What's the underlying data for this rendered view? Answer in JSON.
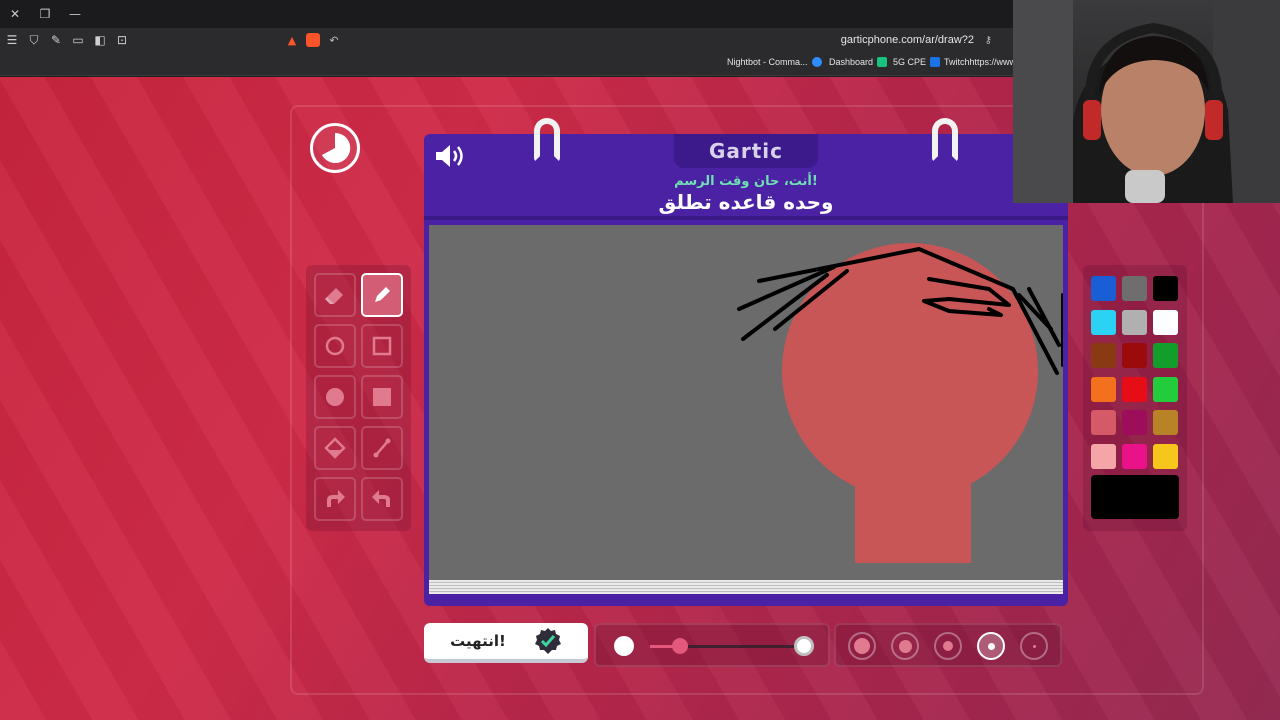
{
  "browser": {
    "window_controls": [
      "✕",
      "❐",
      "—"
    ],
    "url": "garticphone.com/ar/draw?2",
    "bookmarks": [
      {
        "label": "Nightbot - Comma...",
        "color": "#2e8cff"
      },
      {
        "label": "Dashboard",
        "color": "#19c37d"
      },
      {
        "label": "5G CPE",
        "color": "#1a73e8"
      },
      {
        "label": "Twitchhttps://www.t",
        "color": "#9146ff"
      }
    ]
  },
  "game": {
    "brand": "Gartic",
    "subtitle": "أنت، حان وقت الرسم!",
    "prompt": "وحده قاعده تطلق",
    "done_label": "انتهيت!",
    "canvas_bg": "#6b6b6b",
    "selected_color": "#000000",
    "palette": [
      "#1a5ed6",
      "#6e6e6e",
      "#000000",
      "#2bd2f4",
      "#b0b0b0",
      "#ffffff",
      "#8a3a12",
      "#9c0b0b",
      "#139d2a",
      "#f3701c",
      "#e60d16",
      "#22cc3b",
      "#d45a68",
      "#9c0d5a",
      "#b88226",
      "#f4a5a8",
      "#e91289",
      "#f7c61a"
    ],
    "opacity_level": 0.2,
    "brush_size_selected_index": 3
  },
  "icons": {
    "tools": [
      "eraser-icon",
      "pencil-icon",
      "ellipse-outline-icon",
      "rectangle-outline-icon",
      "ellipse-fill-icon",
      "rectangle-fill-icon",
      "bucket-fill-icon",
      "line-icon",
      "undo-icon",
      "redo-icon"
    ]
  }
}
